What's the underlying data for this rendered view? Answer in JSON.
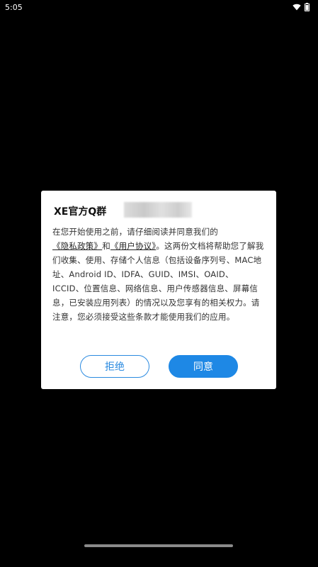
{
  "status_bar": {
    "time": "5:05",
    "wifi_icon": "wifi-icon",
    "battery_icon": "battery-icon"
  },
  "dialog": {
    "title": "XE官方Q群",
    "body": {
      "p1": "在您开始使用之前，请仔细阅读并同意我们的",
      "privacy_link": "《隐私政策》",
      "and": "和",
      "terms_link": "《用户协议》",
      "p2": "。这两份文档将帮助您了解我们收集、使用、存储个人信息（包括设备序列号、MAC地址、Android ID、IDFA、GUID、IMSI、OAID、ICCID、位置信息、网络信息、用户传感器信息、屏幕信息，已安装应用列表）的情况以及您享有的相关权力。请注意，您必须接受这些条款才能使用我们的应用。"
    },
    "reject_label": "拒绝",
    "agree_label": "同意"
  },
  "colors": {
    "accent": "#1e88e5",
    "background": "#000000"
  }
}
